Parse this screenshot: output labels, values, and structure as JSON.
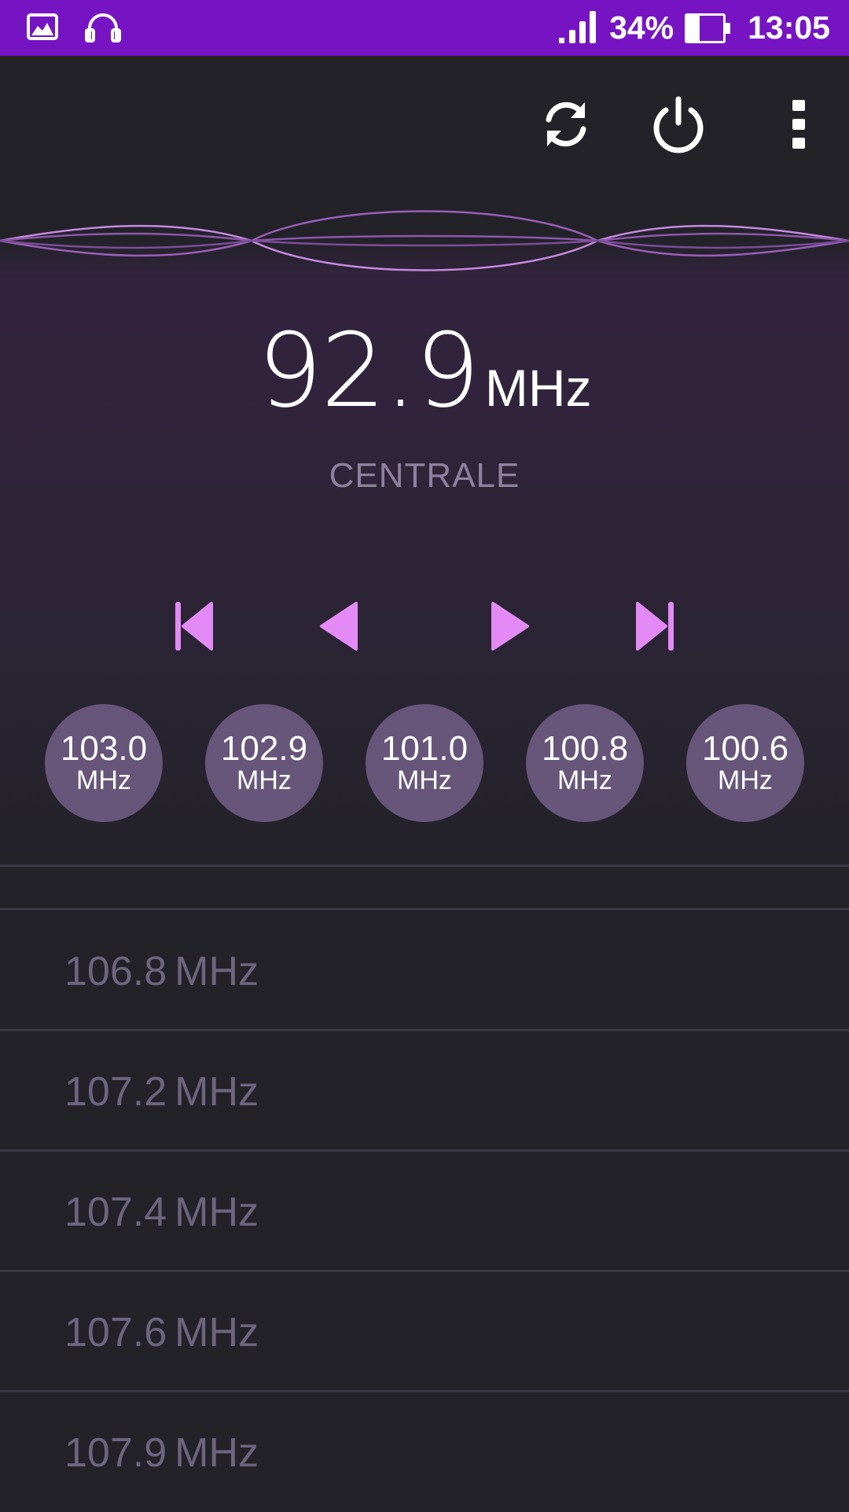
{
  "status_bar": {
    "battery_percent": "34%",
    "time": "13:05",
    "battery_level": 0.34,
    "icons": [
      "gallery-icon",
      "headphones-icon",
      "signal-icon",
      "battery-icon"
    ]
  },
  "toolbar": {
    "icons": [
      "refresh-icon",
      "power-icon",
      "more-vert-icon"
    ]
  },
  "now_playing": {
    "frequency": "92.9",
    "unit": "MHz",
    "station": "CENTRALE"
  },
  "controls": {
    "icons": [
      "skip-previous-icon",
      "step-backward-icon",
      "step-forward-icon",
      "skip-next-icon"
    ]
  },
  "presets": [
    {
      "value": "103.0",
      "unit": "MHz"
    },
    {
      "value": "102.9",
      "unit": "MHz"
    },
    {
      "value": "101.0",
      "unit": "MHz"
    },
    {
      "value": "100.8",
      "unit": "MHz"
    },
    {
      "value": "100.6",
      "unit": "MHz"
    }
  ],
  "stations": [
    {
      "value": "106.8",
      "unit": "MHz"
    },
    {
      "value": "107.2",
      "unit": "MHz"
    },
    {
      "value": "107.4",
      "unit": "MHz"
    },
    {
      "value": "107.6",
      "unit": "MHz"
    },
    {
      "value": "107.9",
      "unit": "MHz"
    }
  ],
  "colors": {
    "status_bar": "#7614c4",
    "background": "#232229",
    "accent": "#e48af6",
    "preset_bg": "#67557a",
    "muted_text": "#6d6580"
  }
}
